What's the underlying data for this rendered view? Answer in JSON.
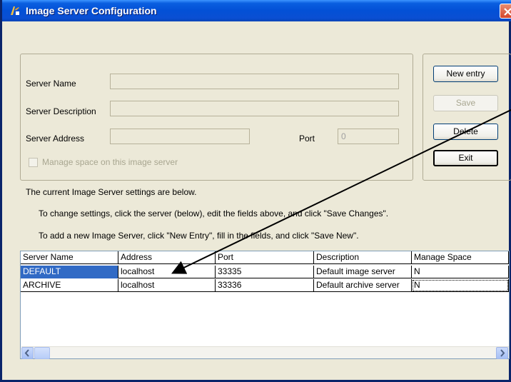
{
  "window": {
    "title": "Image Server Configuration"
  },
  "form": {
    "server_name_label": "Server Name",
    "server_description_label": "Server Description",
    "server_address_label": "Server Address",
    "port_label": "Port",
    "port_value": "0",
    "manage_space_label": "Manage space on this image server"
  },
  "buttons": {
    "new_entry": "New entry",
    "save": "Save",
    "delete": "Delete",
    "exit": "Exit"
  },
  "info": {
    "line1": "The current Image Server settings are below.",
    "line2": "To change settings, click the server (below), edit the fields above, and click \"Save Changes\".",
    "line3": "To add a new Image Server, click \"New Entry\", fill in the fields, and click \"Save New\"."
  },
  "table": {
    "columns": [
      "Server Name",
      "Address",
      "Port",
      "Description",
      "Manage Space"
    ],
    "rows": [
      [
        "DEFAULT",
        "localhost",
        "33335",
        "Default image server",
        "N"
      ],
      [
        "ARCHIVE",
        "localhost",
        "33336",
        "Default archive server",
        "N"
      ]
    ]
  },
  "colors": {
    "titlebar": "#0350d6",
    "selection": "#316ac5",
    "window_bg": "#ece9d8"
  }
}
